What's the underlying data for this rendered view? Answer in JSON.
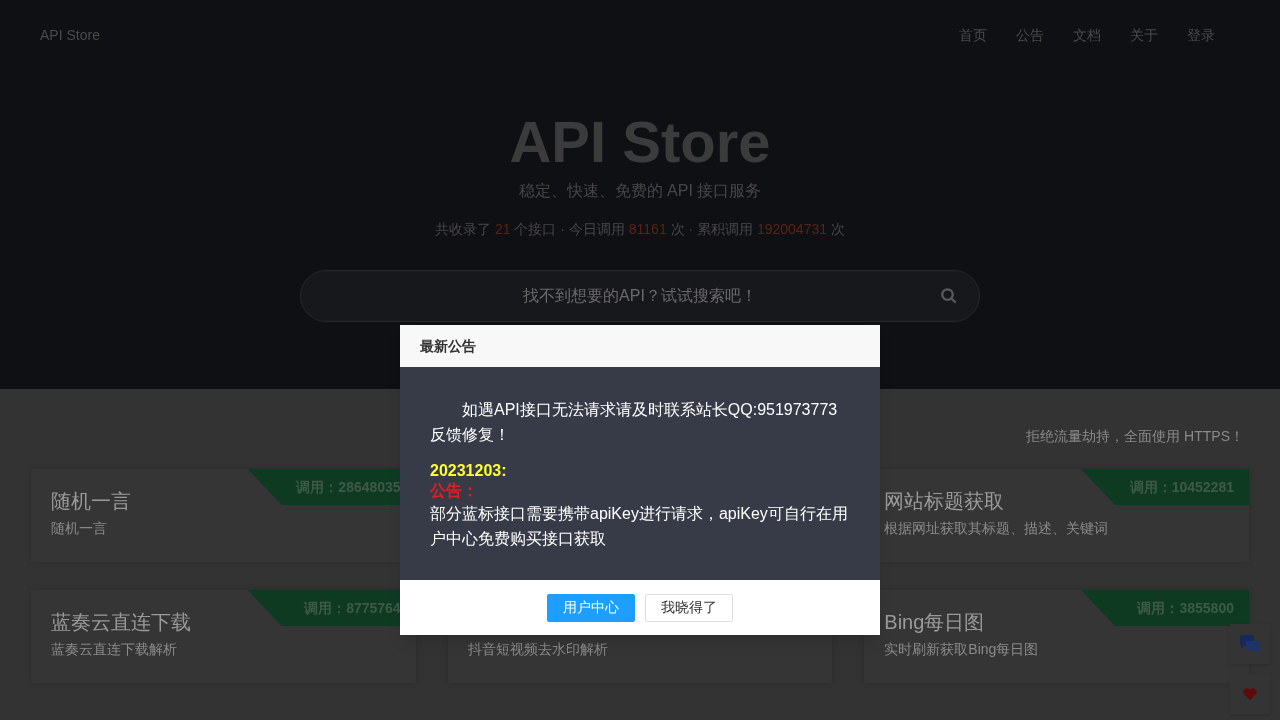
{
  "nav": {
    "brand": "API Store",
    "links": [
      "首页",
      "公告",
      "文档",
      "关于",
      "登录"
    ]
  },
  "hero": {
    "title": "API Store",
    "subtitle": "稳定、快速、免费的 API 接口服务",
    "stats": [
      {
        "kind": "text",
        "text": "共收录了 "
      },
      {
        "kind": "number",
        "text": "21"
      },
      {
        "kind": "text",
        "text": " 个接口 · 今日调用 "
      },
      {
        "kind": "number",
        "text": "81161"
      },
      {
        "kind": "text",
        "text": " 次 · 累积调用 "
      },
      {
        "kind": "number",
        "text": "192004731"
      },
      {
        "kind": "text",
        "text": " 次"
      }
    ]
  },
  "search": {
    "placeholder": "找不到想要的API？试试搜索吧！"
  },
  "notice": "拒绝流量劫持，全面使用 HTTPS！",
  "cards": [
    {
      "left": {
        "title": "随机一言",
        "description": "随机一言",
        "calls": "调用：28648035"
      },
      "right": {
        "title": "网站标题获取",
        "description": "根据网址获取其标题、描述、关键词",
        "calls": "调用：10452281"
      }
    },
    {
      "left": {
        "title": "蓝奏云直连下载",
        "description": "蓝奏云直连下载解析",
        "calls": "调用：8775764"
      },
      "center": {
        "description": "抖音短视频去水印解析"
      },
      "right": {
        "title": "Bing每日图",
        "description": "实时刷新获取Bing每日图",
        "calls": "调用：3855800"
      }
    }
  ],
  "modal": {
    "title": "最新公告",
    "message": "如遇API接口无法请求请及时联系站长QQ:951973773反馈修复！",
    "date": "20231203:",
    "label": "公告：",
    "body": "部分蓝标接口需要携带apiKey进行请求，apiKey可自行在用户中心免费购买接口获取",
    "buttons": [
      {
        "kind": "primary",
        "label": "用户中心"
      },
      {
        "kind": "default",
        "label": "我晓得了"
      }
    ]
  }
}
